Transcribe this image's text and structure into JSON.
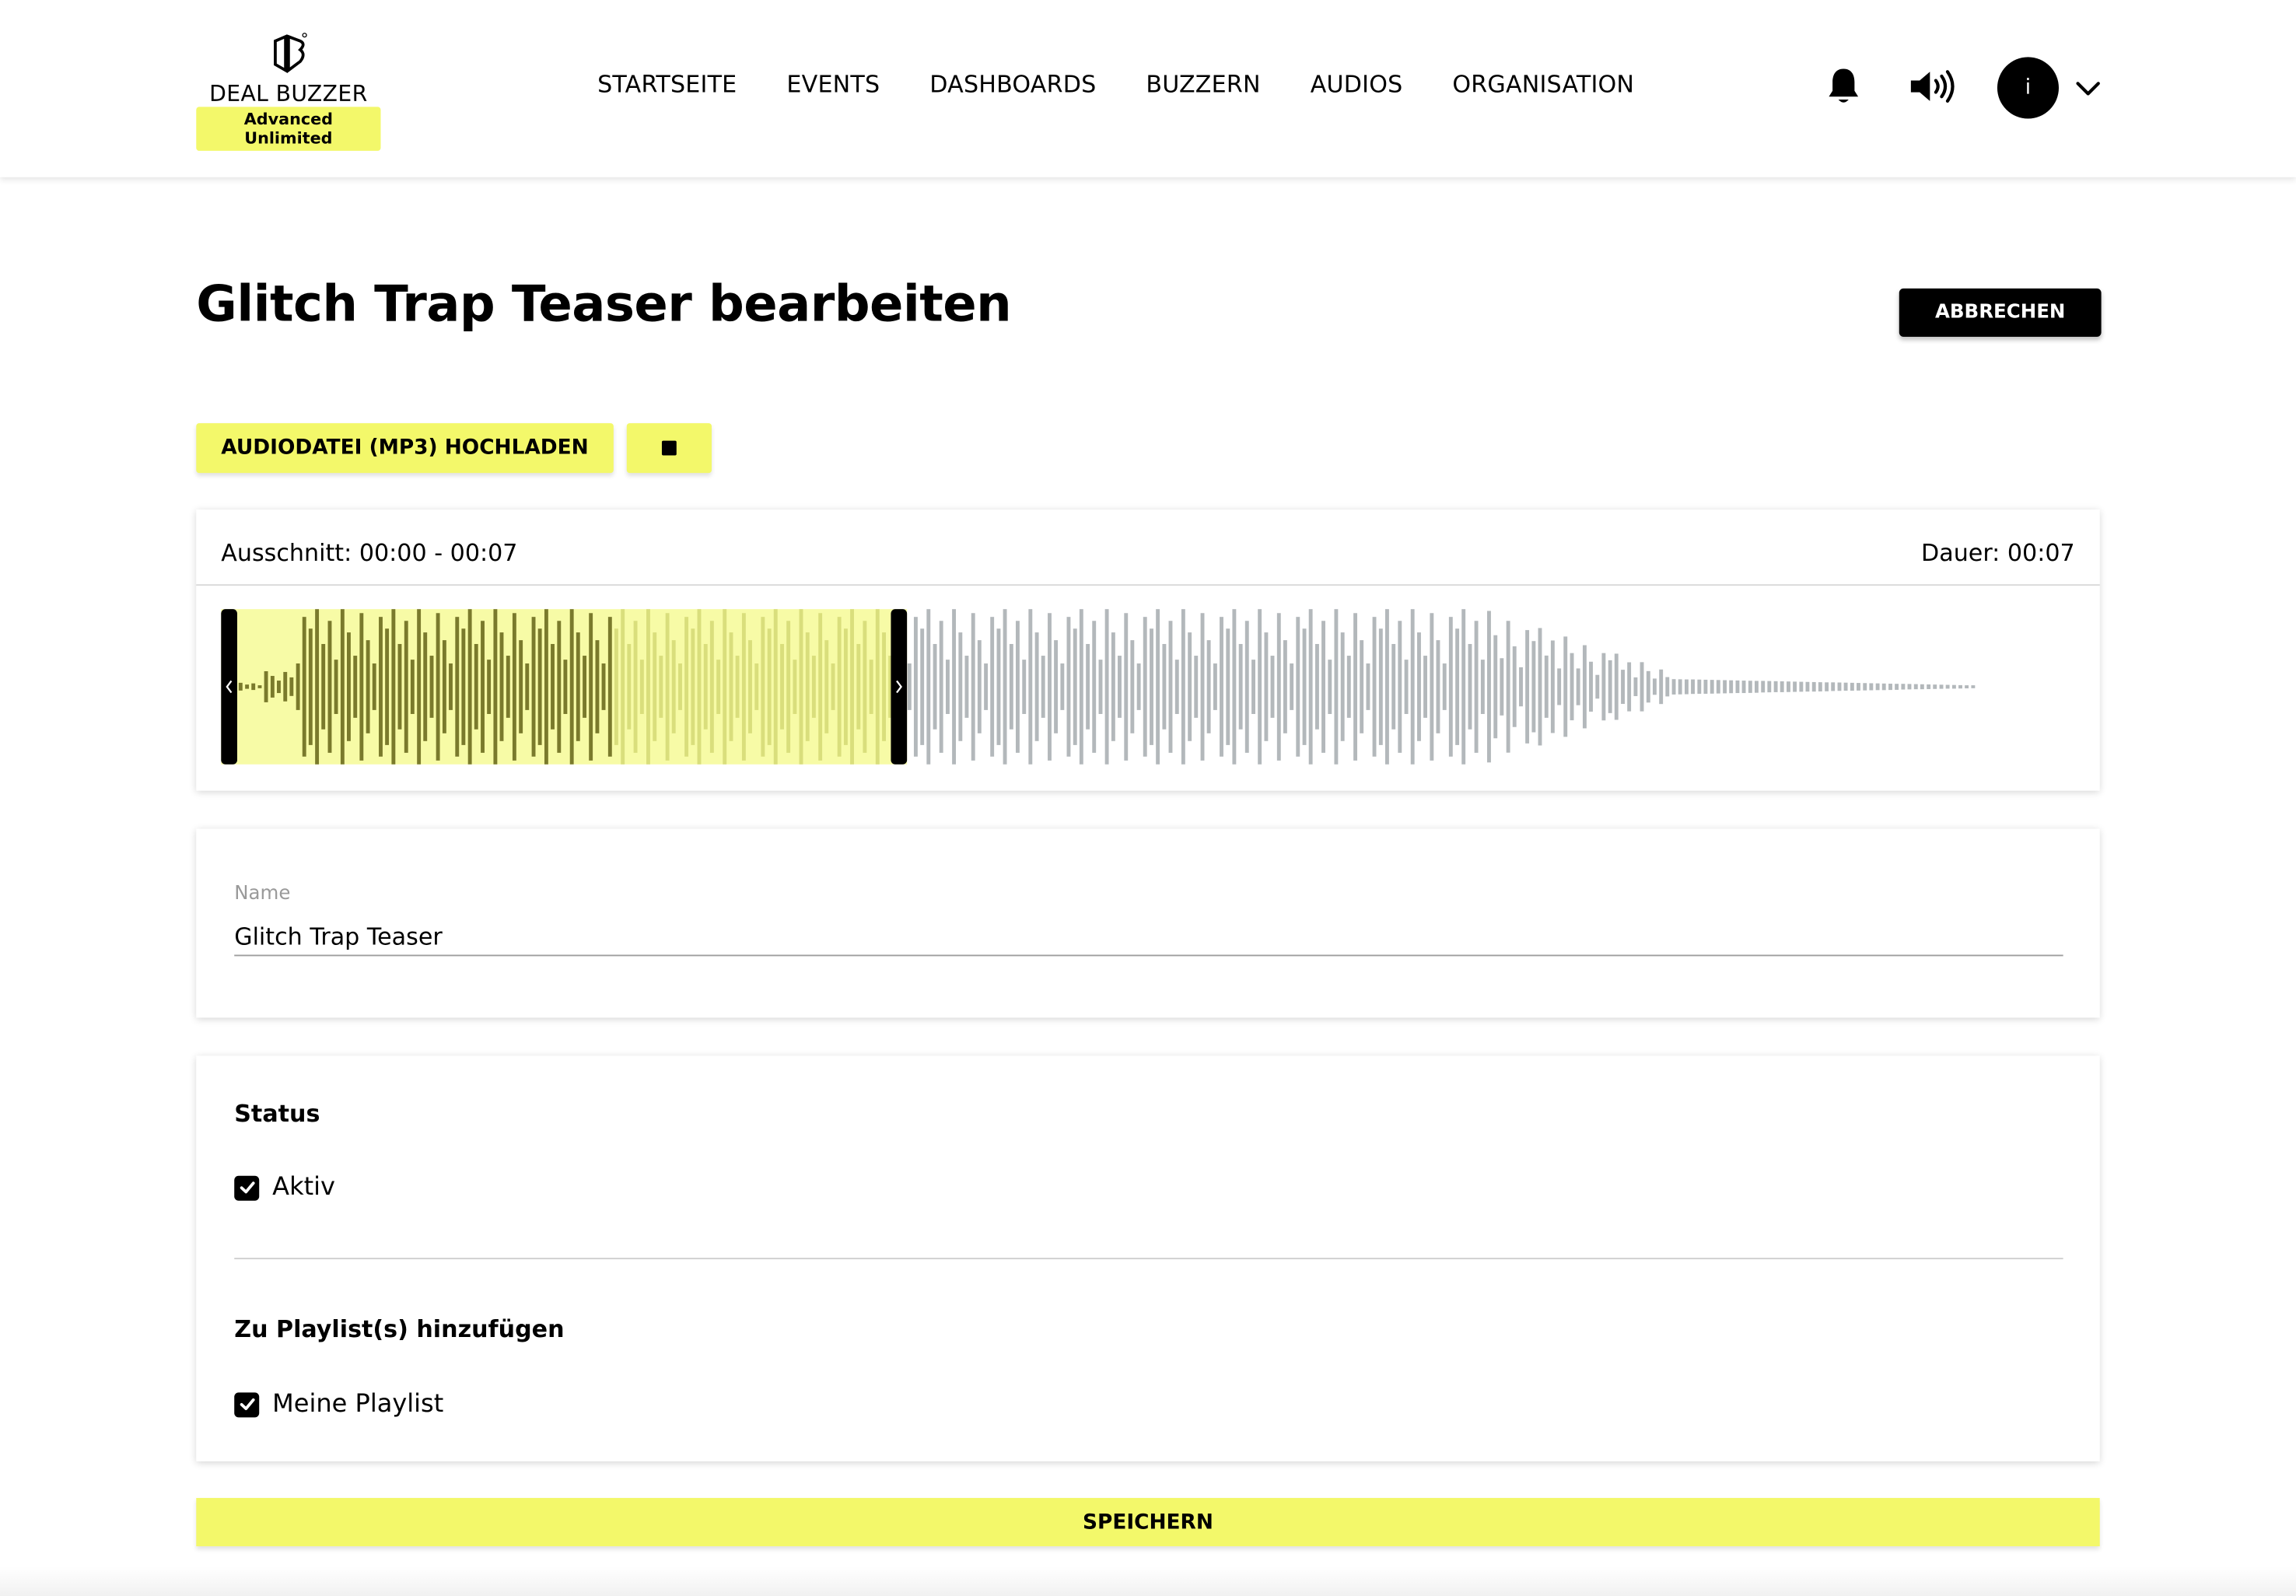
{
  "brand": {
    "name": "DEAL BUZZER",
    "badge": "Advanced Unlimited"
  },
  "nav": {
    "items": [
      "STARTSEITE",
      "EVENTS",
      "DASHBOARDS",
      "BUZZERN",
      "AUDIOS",
      "ORGANISATION"
    ]
  },
  "header_icons": [
    "bell-icon",
    "speaker-icon",
    "chevron-down-icon"
  ],
  "user": {
    "avatar_initial": "i"
  },
  "page": {
    "title": "Glitch Trap Teaser bearbeiten",
    "cancel_label": "ABBRECHEN"
  },
  "upload": {
    "upload_label": "AUDIODATEI (MP3) HOCHLADEN",
    "stop_icon": "stop-icon"
  },
  "waveform": {
    "range_label": "Ausschnitt: 00:00 - 00:07",
    "duration_label": "Dauer: 00:07",
    "selection_start_fraction": 0.0,
    "selection_end_fraction": 0.37,
    "colors": {
      "selection_bg": "#f7fba6",
      "bar_selected_dark": "#7a7a2c",
      "bar_selected_light": "#d9de7c",
      "bar_unselected": "#b3b8bb",
      "handle": "#000000"
    }
  },
  "name_field": {
    "label": "Name",
    "value": "Glitch Trap Teaser"
  },
  "status": {
    "title": "Status",
    "active_label": "Aktiv",
    "active_checked": true
  },
  "playlists": {
    "title": "Zu Playlist(s) hinzufügen",
    "items": [
      {
        "label": "Meine Playlist",
        "checked": true
      }
    ]
  },
  "save_label": "SPEICHERN",
  "colors": {
    "accent": "#f3f86a",
    "dark": "#000000"
  }
}
